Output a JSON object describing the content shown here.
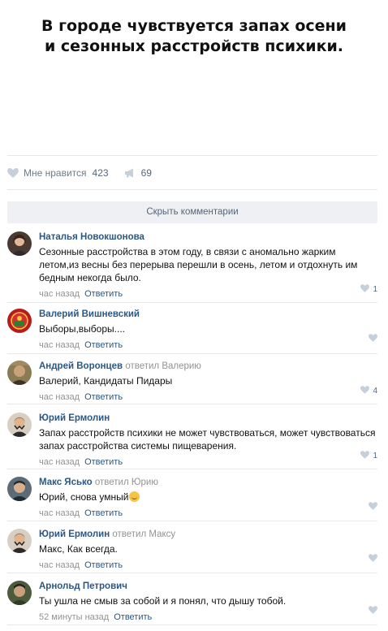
{
  "post": {
    "title_line1": "В городе чувствуется запах осени",
    "title_line2": "и сезонных расстройств психики."
  },
  "actions": {
    "like_label": "Мне нравится",
    "like_count": "423",
    "share_count": "69"
  },
  "hide_comments_label": "Скрыть комментарии",
  "comments": [
    {
      "author": "Наталья Новокшонова",
      "replied_to": "",
      "text": "Сезонные расстройства в этом году, в связи с аномально жарким летом,из весны без перерыва перешли в осень, летом и отдохнуть им бедным некогда было.",
      "time": "час назад",
      "reply_label": "Ответить",
      "likes": "1"
    },
    {
      "author": "Валерий Вишневский",
      "replied_to": "",
      "text": "Выборы,выборы....",
      "time": "час назад",
      "reply_label": "Ответить",
      "likes": ""
    },
    {
      "author": "Андрей Воронцев",
      "replied_to": "ответил Валерию",
      "text": "Валерий, Кандидаты Пидары",
      "time": "час назад",
      "reply_label": "Ответить",
      "likes": "4"
    },
    {
      "author": "Юрий Ермолин",
      "replied_to": "",
      "text": "Запах расстройств психики не может чувствоваться, может чувствоваться запах расстройства системы пищеварения.",
      "time": "час назад",
      "reply_label": "Ответить",
      "likes": "1"
    },
    {
      "author": "Макс Ясько",
      "replied_to": "ответил Юрию",
      "text": "Юрий, снова умный",
      "emoji": "laughing-emoji",
      "time": "час назад",
      "reply_label": "Ответить",
      "likes": ""
    },
    {
      "author": "Юрий Ермолин",
      "replied_to": "ответил Максу",
      "text": "Макс, Как всегда.",
      "time": "час назад",
      "reply_label": "Ответить",
      "likes": ""
    },
    {
      "author": "Арнольд Петрович",
      "replied_to": "",
      "text": "Ты ушла не смыв за собой и я понял, что дышу тобой.",
      "time": "52 минуты назад",
      "reply_label": "Ответить",
      "likes": ""
    }
  ],
  "colors": {
    "link": "#2a5885",
    "muted": "#939393",
    "icon": "#c5d0db",
    "divider": "#e7e8ec"
  }
}
